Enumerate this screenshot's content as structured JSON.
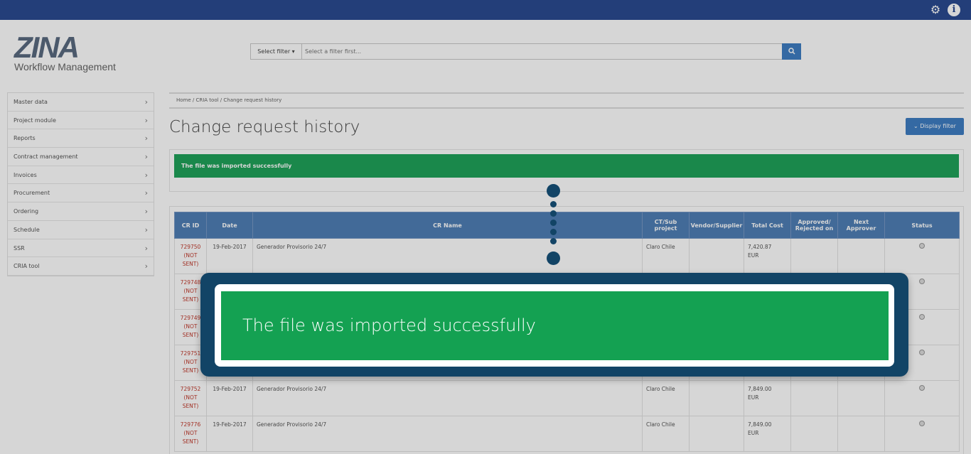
{
  "topbar": {
    "settings_icon": "gear-icon",
    "info_icon": "info-icon",
    "info_glyph": "i"
  },
  "logo": {
    "name": "ZINA",
    "subtitle": "Workflow Management"
  },
  "filter": {
    "select_label": "Select filter ▾",
    "placeholder": "Select a filter first..."
  },
  "sidebar": {
    "items": [
      {
        "label": "Master data"
      },
      {
        "label": "Project module"
      },
      {
        "label": "Reports"
      },
      {
        "label": "Contract management"
      },
      {
        "label": "Invoices"
      },
      {
        "label": "Procurement"
      },
      {
        "label": "Ordering"
      },
      {
        "label": "Schedule"
      },
      {
        "label": "SSR"
      },
      {
        "label": "CRIA tool"
      }
    ]
  },
  "breadcrumb": "Home  /  CRIA tool  /  Change request history",
  "page": {
    "title": "Change request history",
    "display_filter": "Display filter"
  },
  "alert": {
    "message": "The file was imported successfully"
  },
  "table": {
    "headers": [
      "CR ID",
      "Date",
      "CR Name",
      "CT/Sub project",
      "Vendor/Supplier",
      "Total Cost",
      "Approved/ Rejected on",
      "Next Approver",
      "Status"
    ],
    "rows": [
      {
        "id": "729750",
        "state": "(NOT SENT)",
        "date": "19-Feb-2017",
        "name": "Generador Provisorio 24/7",
        "ct": "Claro Chile",
        "vendor": "",
        "cost": "7,420.87",
        "currency": "EUR",
        "approved": "",
        "next": ""
      },
      {
        "id": "729748",
        "state": "(NOT SENT)",
        "date": "",
        "name": "",
        "ct": "",
        "vendor": "",
        "cost": "",
        "currency": "",
        "approved": "",
        "next": ""
      },
      {
        "id": "729749",
        "state": "(NOT SENT)",
        "date": "",
        "name": "",
        "ct": "",
        "vendor": "",
        "cost": "",
        "currency": "",
        "approved": "",
        "next": ""
      },
      {
        "id": "729751",
        "state": "(NOT SENT)",
        "date": "",
        "name": "",
        "ct": "",
        "vendor": "",
        "cost": "",
        "currency": "",
        "approved": "",
        "next": ""
      },
      {
        "id": "729752",
        "state": "(NOT SENT)",
        "date": "19-Feb-2017",
        "name": "Generador Provisorio 24/7",
        "ct": "Claro Chile",
        "vendor": "",
        "cost": "7,849.00",
        "currency": "EUR",
        "approved": "",
        "next": ""
      },
      {
        "id": "729776",
        "state": "(NOT SENT)",
        "date": "19-Feb-2017",
        "name": "Generador Provisorio 24/7",
        "ct": "Claro Chile",
        "vendor": "",
        "cost": "7,849.00",
        "currency": "EUR",
        "approved": "",
        "next": ""
      }
    ]
  },
  "callout": {
    "message": "The file was imported successfully"
  }
}
